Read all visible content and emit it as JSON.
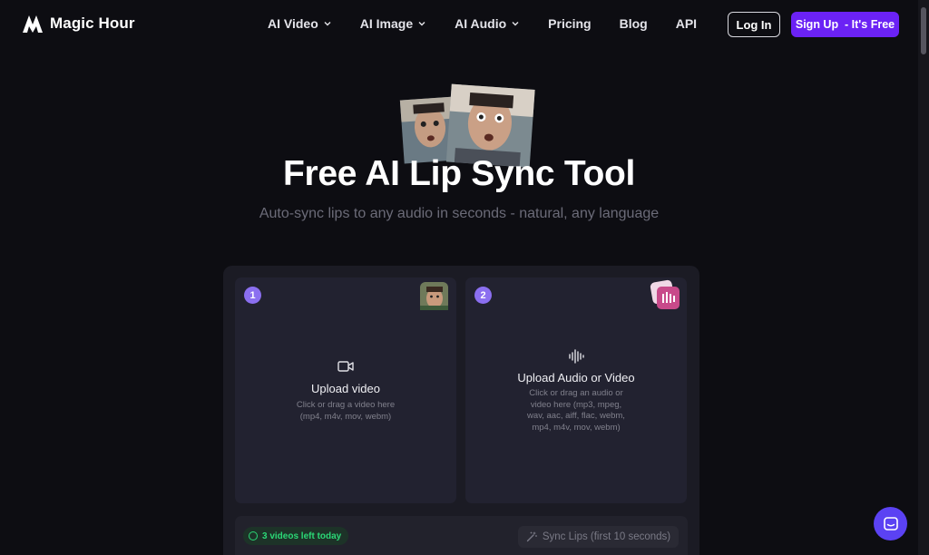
{
  "brand": {
    "name": "Magic Hour"
  },
  "nav": {
    "items": [
      {
        "label": "AI Video",
        "dropdown": true
      },
      {
        "label": "AI Image",
        "dropdown": true
      },
      {
        "label": "AI Audio",
        "dropdown": true
      },
      {
        "label": "Pricing",
        "dropdown": false
      },
      {
        "label": "Blog",
        "dropdown": false
      },
      {
        "label": "API",
        "dropdown": false
      }
    ],
    "login_label": "Log In",
    "signup_label": "Sign Up  - It's Free"
  },
  "hero": {
    "title": "Free AI Lip Sync Tool",
    "subtitle": "Auto-sync lips to any audio in seconds - natural, any language"
  },
  "upload_video": {
    "step": "1",
    "icon": "video-camera-icon",
    "title": "Upload video",
    "desc_lines": [
      "Click or drag a video here",
      "(mp4, m4v, mov, webm)"
    ]
  },
  "upload_audio": {
    "step": "2",
    "icon": "audio-wave-icon",
    "title": "Upload Audio or Video",
    "desc_lines": [
      "Click or drag an audio or",
      "video here (mp3, mpeg,",
      "wav, aac, aiff, flac, webm,",
      "mp4, m4v, mov, webm)"
    ]
  },
  "status": {
    "videos_left": "3 videos left today"
  },
  "action": {
    "sync_label": "Sync Lips (first 10 seconds)"
  },
  "colors": {
    "accent": "#6b22f5",
    "badge": "#8b6ff0",
    "success": "#2bd876",
    "chat": "#5b42f3"
  }
}
